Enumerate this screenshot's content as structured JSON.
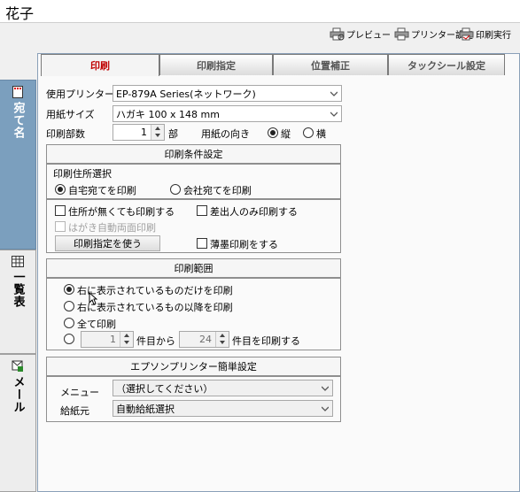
{
  "app": {
    "title": "花子"
  },
  "toolbar": {
    "preview": "プレビュー",
    "printer_settings": "プリンター設定",
    "print_run": "印刷実行"
  },
  "sidebar": {
    "items": [
      {
        "label": "宛て名"
      },
      {
        "label": "一覧表"
      },
      {
        "label": "メール"
      }
    ]
  },
  "tabs": [
    {
      "label": "印刷"
    },
    {
      "label": "印刷指定"
    },
    {
      "label": "位置補正"
    },
    {
      "label": "タックシール設定"
    }
  ],
  "form": {
    "printer_label": "使用プリンター",
    "printer_value": "EP-879A Series(ネットワーク)",
    "paper_label": "用紙サイズ",
    "paper_value": "ハガキ 100 x 148 mm",
    "copies_label": "印刷部数",
    "copies_value": "1",
    "copies_unit": "部",
    "orientation_label": "用紙の向き",
    "portrait": "縦",
    "landscape": "横"
  },
  "conditions": {
    "header": "印刷条件設定",
    "address_select": "印刷住所選択",
    "home": "自宅宛てを印刷",
    "company": "会社宛てを印刷",
    "no_address": "住所が無くても印刷する",
    "sender_only": "差出人のみ印刷する",
    "auto_duplex": "はがき自動両面印刷",
    "use_spec_button": "印刷指定を使う",
    "thin_ink": "薄墨印刷をする"
  },
  "range": {
    "header": "印刷範囲",
    "only_right": "右に表示されているものだけを印刷",
    "from_right": "右に表示されているもの以降を印刷",
    "all": "全て印刷",
    "from_value": "1",
    "from_text": "件目から",
    "to_value": "24",
    "to_text": "件目を印刷する"
  },
  "epson": {
    "header": "エプソンプリンター簡単設定",
    "menu_label": "メニュー",
    "menu_value": "（選択してください）",
    "feed_label": "給紙元",
    "feed_value": "自動給紙選択"
  }
}
